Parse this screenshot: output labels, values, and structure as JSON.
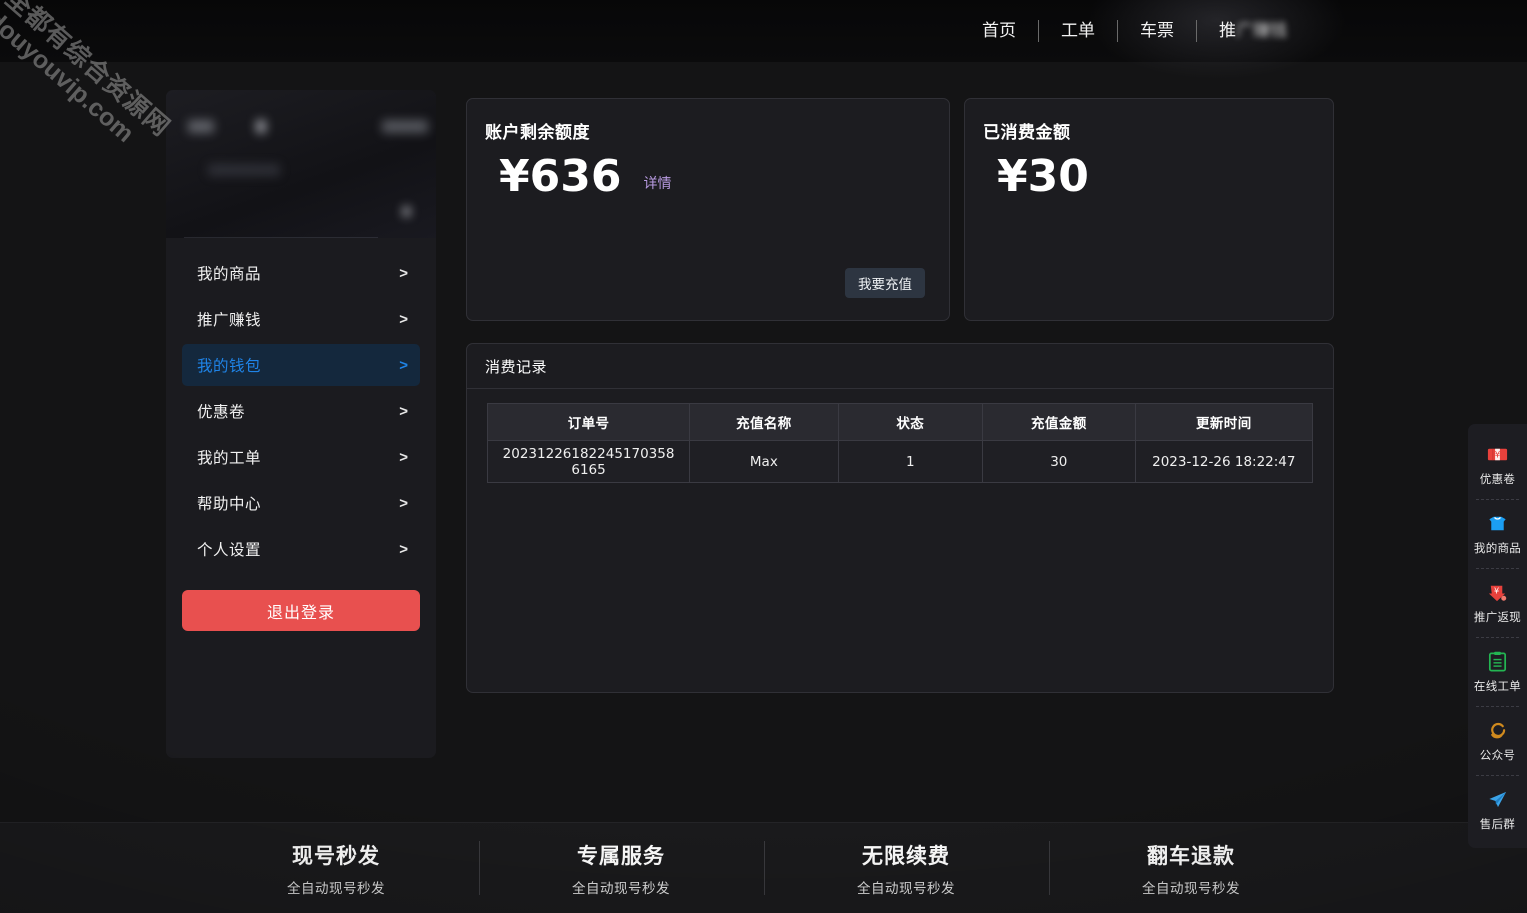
{
  "watermark": {
    "cn": "全都有综合资源网",
    "en": "douyouvip.com"
  },
  "topnav": {
    "items": [
      {
        "label": "首页"
      },
      {
        "label": "工单"
      },
      {
        "label": "车票"
      },
      {
        "label": "推广赚钱",
        "blurred": true
      }
    ]
  },
  "sidebar": {
    "menu": [
      {
        "label": "我的商品",
        "arrow": ">",
        "active": false
      },
      {
        "label": "推广赚钱",
        "arrow": ">",
        "active": false
      },
      {
        "label": "我的钱包",
        "arrow": ">",
        "active": true
      },
      {
        "label": "优惠卷",
        "arrow": ">",
        "active": false
      },
      {
        "label": "我的工单",
        "arrow": ">",
        "active": false
      },
      {
        "label": "帮助中心",
        "arrow": ">",
        "active": false
      },
      {
        "label": "个人设置",
        "arrow": ">",
        "active": false
      }
    ],
    "logout_label": "退出登录",
    "logout_color": "#e8504f",
    "active_text_color": "#1f84e8",
    "active_bg_color": "#14283d"
  },
  "cards": {
    "balance": {
      "title": "账户剩余额度",
      "amount": "¥636",
      "detail_link": "详情",
      "detail_link_color": "#b79ae0",
      "recharge_label": "我要充值"
    },
    "spent": {
      "title": "已消费金额",
      "amount": "¥30"
    }
  },
  "record_panel": {
    "title": "消费记录",
    "columns": [
      "订单号",
      "充值名称",
      "状态",
      "充值金额",
      "更新时间"
    ],
    "rows": [
      {
        "order_no": "20231226182245170358 6165",
        "recharge_name": "Max",
        "status": "1",
        "amount": "30",
        "update_time": "2023-12-26 18:22:47"
      }
    ]
  },
  "dock": {
    "items": [
      {
        "label": "优惠卷",
        "icon": "coupon-ticket-icon",
        "color": "#e8413c"
      },
      {
        "label": "我的商品",
        "icon": "shopping-bag-icon",
        "color": "#1b9ef3"
      },
      {
        "label": "推广返现",
        "icon": "cashback-arrow-icon",
        "color": "#e8413c"
      },
      {
        "label": "在线工单",
        "icon": "clipboard-icon",
        "color": "#23b552"
      },
      {
        "label": "公众号",
        "icon": "swirl-icon",
        "color": "#d08a1e"
      },
      {
        "label": "售后群",
        "icon": "telegram-plane-icon",
        "color": "#3ba3e8"
      }
    ]
  },
  "footer": {
    "columns": [
      {
        "title": "现号秒发",
        "subtitle": "全自动现号秒发"
      },
      {
        "title": "专属服务",
        "subtitle": "全自动现号秒发"
      },
      {
        "title": "无限续费",
        "subtitle": "全自动现号秒发"
      },
      {
        "title": "翻车退款",
        "subtitle": "全自动现号秒发"
      }
    ]
  }
}
